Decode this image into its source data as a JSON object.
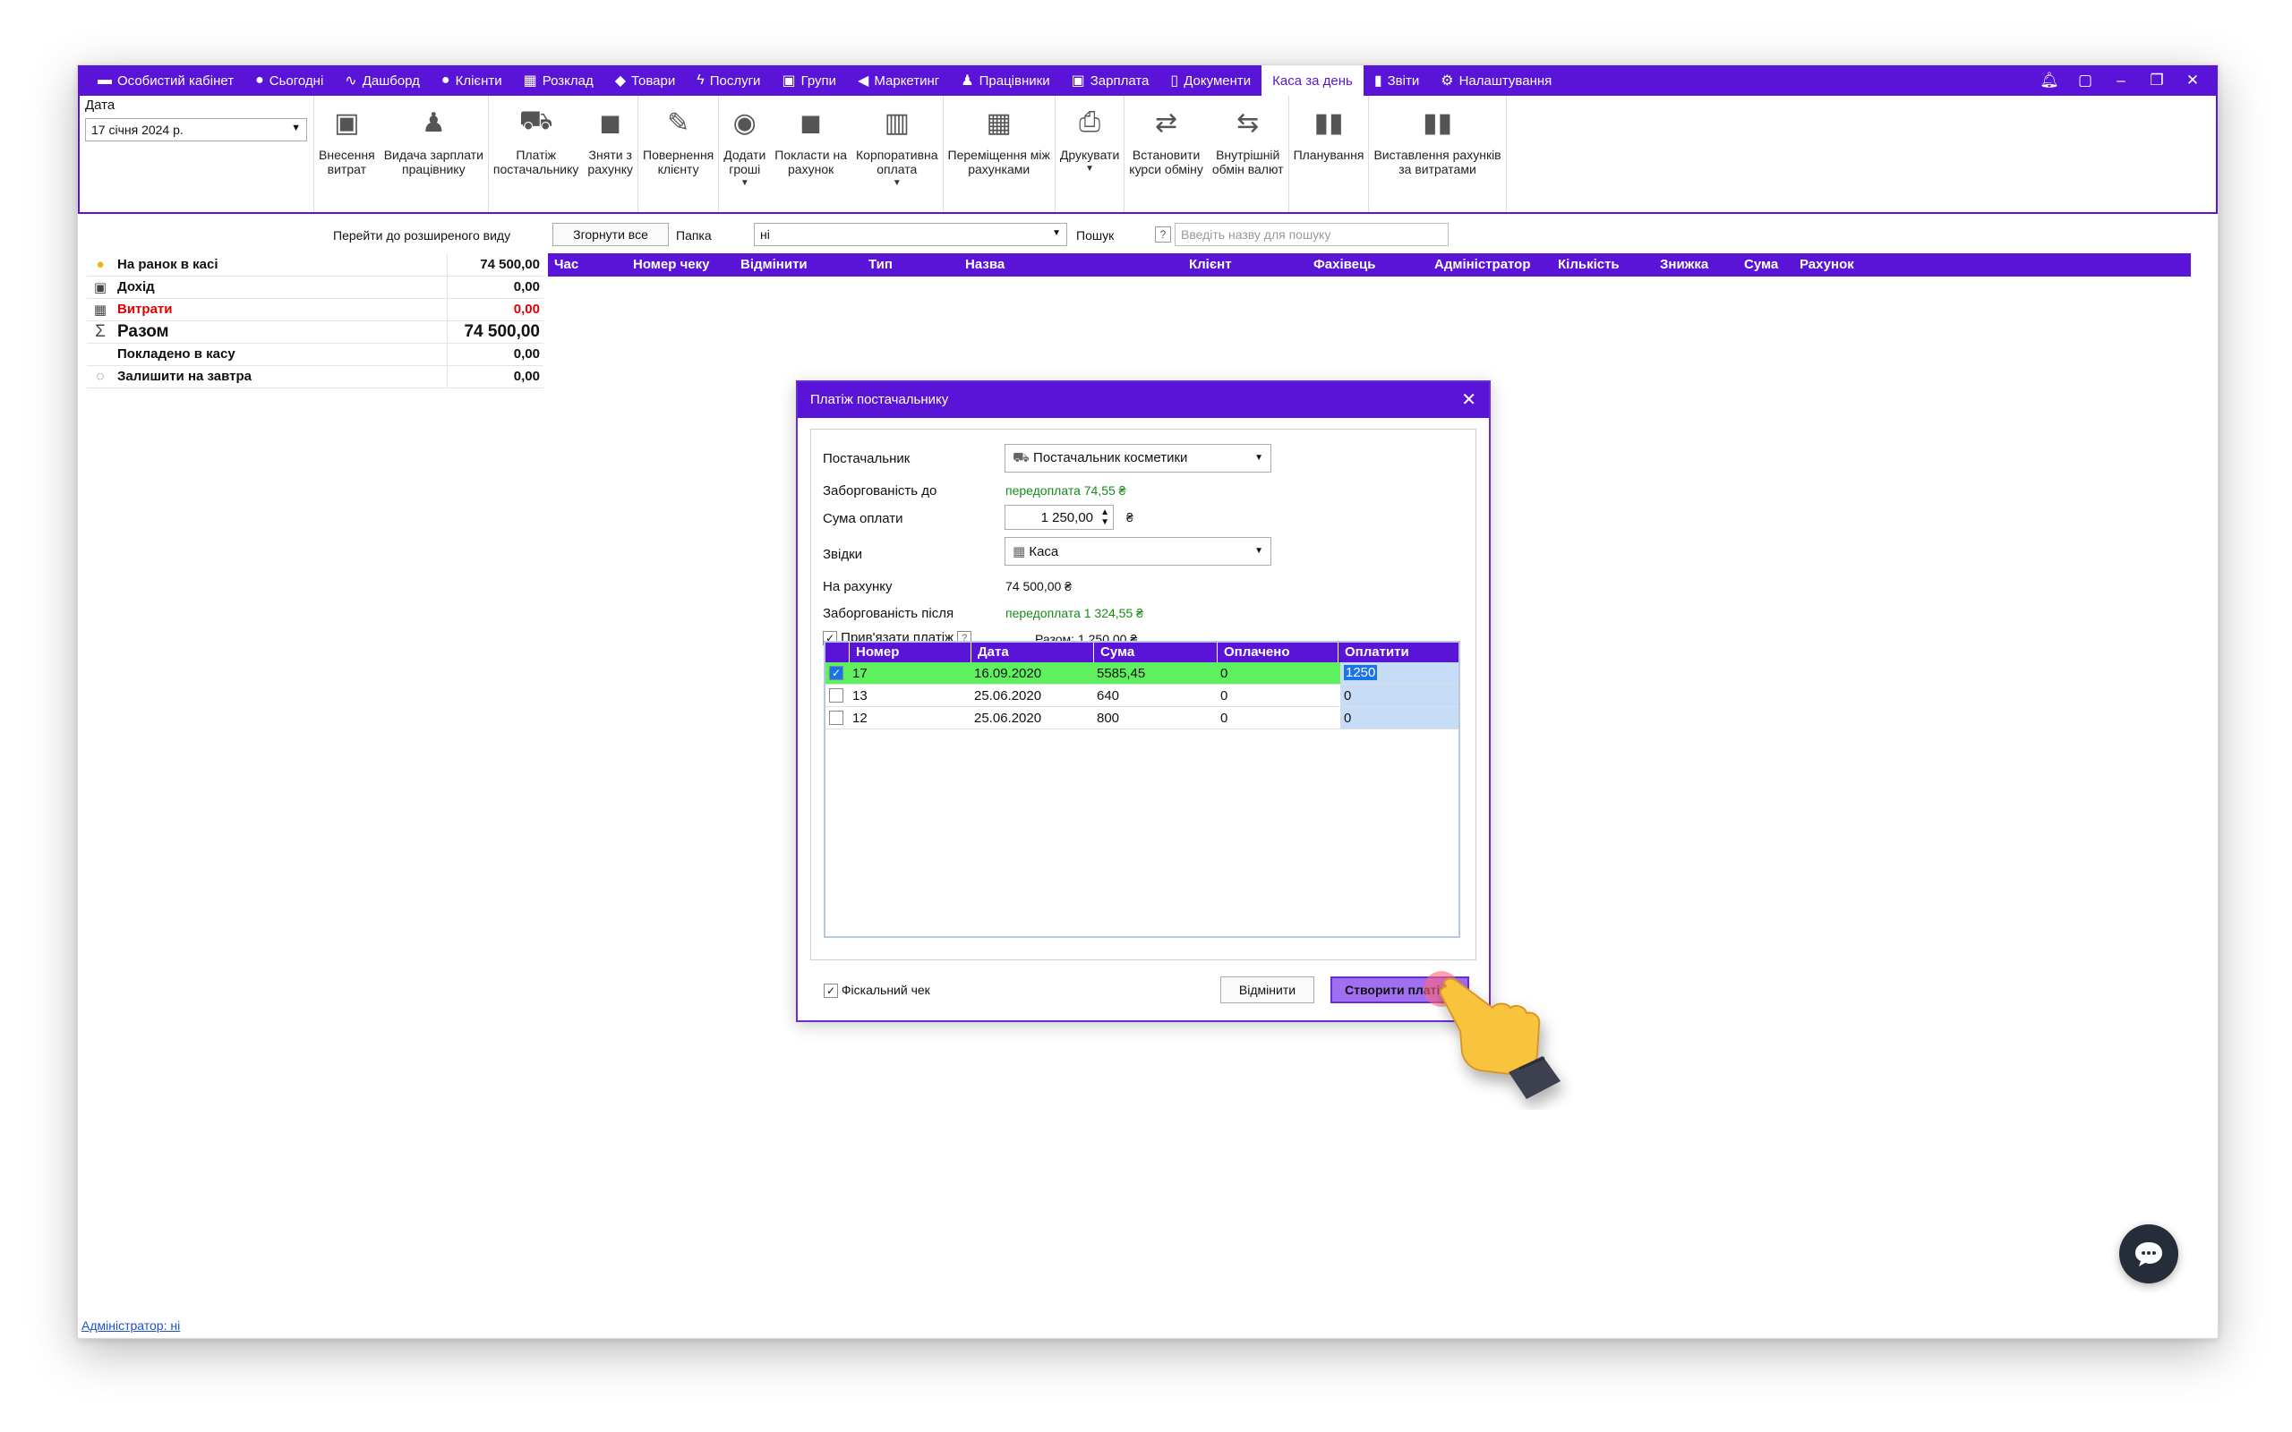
{
  "nav": {
    "items": [
      {
        "label": "Особистий кабінет",
        "icon": "wallet-icon",
        "glyph": "▬"
      },
      {
        "label": "Сьогодні",
        "icon": "clock-icon",
        "glyph": "●"
      },
      {
        "label": "Дашборд",
        "icon": "pulse-icon",
        "glyph": "∿"
      },
      {
        "label": "Клієнти",
        "icon": "user-circle-icon",
        "glyph": "●"
      },
      {
        "label": "Розклад",
        "icon": "calendar-icon",
        "glyph": "▦"
      },
      {
        "label": "Товари",
        "icon": "box-icon",
        "glyph": "◆"
      },
      {
        "label": "Послуги",
        "icon": "bolt-icon",
        "glyph": "ϟ"
      },
      {
        "label": "Групи",
        "icon": "group-icon",
        "glyph": "▣"
      },
      {
        "label": "Маркетинг",
        "icon": "megaphone-icon",
        "glyph": "◀"
      },
      {
        "label": "Працівники",
        "icon": "person-icon",
        "glyph": "♟"
      },
      {
        "label": "Зарплата",
        "icon": "money-icon",
        "glyph": "▣"
      },
      {
        "label": "Документи",
        "icon": "document-icon",
        "glyph": "▯"
      },
      {
        "label": "Каса за день",
        "icon": "",
        "glyph": "",
        "active": true
      },
      {
        "label": "Звіти",
        "icon": "bar-chart-icon",
        "glyph": "▮"
      },
      {
        "label": "Налаштування",
        "icon": "gear-icon",
        "glyph": "⚙"
      }
    ]
  },
  "date": {
    "label": "Дата",
    "value": "17 січня 2024 р."
  },
  "ribbon": {
    "groups": [
      [
        {
          "label": "Внесення\nвитрат",
          "icon": "cash-icon",
          "glyph": "▣"
        },
        {
          "label": "Видача зарплати\nпрацівнику",
          "icon": "employee-money-icon",
          "glyph": "♟"
        }
      ],
      [
        {
          "label": "Платіж\nпостачальнику",
          "icon": "truck-icon",
          "glyph": "⛟"
        },
        {
          "label": "Зняти з\nрахунку",
          "icon": "withdraw-icon",
          "glyph": "◼"
        }
      ],
      [
        {
          "label": "Повернення\nклієнту",
          "icon": "refund-icon",
          "glyph": "✎"
        }
      ],
      [
        {
          "label": "Додати\nгроші",
          "icon": "coins-icon",
          "glyph": "◉",
          "caret": true
        },
        {
          "label": "Покласти на\nрахунок",
          "icon": "deposit-icon",
          "glyph": "◼"
        },
        {
          "label": "Корпоративна\nоплата",
          "icon": "building-icon",
          "glyph": "▥",
          "caret": true
        }
      ],
      [
        {
          "label": "Переміщення між\nрахунками",
          "icon": "calculator-icon",
          "glyph": "▦"
        }
      ],
      [
        {
          "label": "Друкувати",
          "icon": "printer-icon",
          "glyph": "⎙",
          "caret": true
        }
      ],
      [
        {
          "label": "Встановити\nкурси обміну",
          "icon": "exchange-rate-icon",
          "glyph": "⇄"
        },
        {
          "label": "Внутрішній\nобмін валют",
          "icon": "currency-exchange-icon",
          "glyph": "⇆"
        }
      ],
      [
        {
          "label": "Планування",
          "icon": "planning-icon",
          "glyph": "▮▮"
        }
      ],
      [
        {
          "label": "Виставлення рахунків\nза витратами",
          "icon": "invoice-chart-icon",
          "glyph": "▮▮"
        }
      ]
    ]
  },
  "toolbar": {
    "advanced_link": "Перейти до розширеного виду",
    "collapse_label": "Згорнути все",
    "folder_label": "Папка",
    "folder_value": "ні",
    "search_label": "Пошук",
    "search_placeholder": "Введіть назву для пошуку"
  },
  "summary": {
    "rows": [
      {
        "label": "На ранок в касі",
        "value": "74 500,00",
        "icon": "coin-icon",
        "glyph": "●"
      },
      {
        "label": "Дохід",
        "value": "0,00",
        "icon": "cash-icon",
        "glyph": "▣"
      },
      {
        "label": "Витрати",
        "value": "0,00",
        "icon": "calculator-icon",
        "glyph": "▦"
      },
      {
        "label": "Разом",
        "value": "74 500,00",
        "icon": "sigma-icon",
        "glyph": "Σ"
      },
      {
        "label": "Покладено в касу",
        "value": "0,00",
        "icon": "",
        "glyph": ""
      },
      {
        "label": "Залишити на завтра",
        "value": "0,00",
        "icon": "calendar-icon",
        "glyph": "◌"
      }
    ]
  },
  "grid": {
    "columns": [
      "Час",
      "Номер чеку",
      "Відмінити",
      "Тип",
      "Назва",
      "Клієнт",
      "Фахівець",
      "Адміністратор",
      "Кількість",
      "Знижка",
      "Сума",
      "Рахунок"
    ]
  },
  "admin_link": "Адміністратор: ні",
  "dialog": {
    "title": "Платіж постачальнику",
    "supplier_label": "Постачальник",
    "supplier_value": "Постачальник косметики",
    "debt_before_label": "Заборгованість до",
    "debt_before_value": "передоплата 74,55 ₴",
    "amount_label": "Сума оплати",
    "amount_value": "1 250,00",
    "currency": "₴",
    "source_label": "Звідки",
    "source_value": "Каса",
    "on_account_label": "На рахунку",
    "on_account_value": "74 500,00 ₴",
    "debt_after_label": "Заборгованість після",
    "debt_after_value": "передоплата 1 324,55 ₴",
    "bind_label": "Прив'язати платіж",
    "total_label": "Разом: 1 250,00 ₴",
    "table": {
      "columns": [
        "Номер",
        "Дата",
        "Сума",
        "Оплачено",
        "Оплатити"
      ],
      "rows": [
        {
          "checked": true,
          "number": "17",
          "date": "16.09.2020",
          "sum": "5585,45",
          "paid": "0",
          "pay": "1250"
        },
        {
          "checked": false,
          "number": "13",
          "date": "25.06.2020",
          "sum": "640",
          "paid": "0",
          "pay": "0"
        },
        {
          "checked": false,
          "number": "12",
          "date": "25.06.2020",
          "sum": "800",
          "paid": "0",
          "pay": "0"
        }
      ]
    },
    "fiscal_label": "Фіскальний чек",
    "cancel_label": "Відмінити",
    "create_label": "Створити платіж"
  }
}
